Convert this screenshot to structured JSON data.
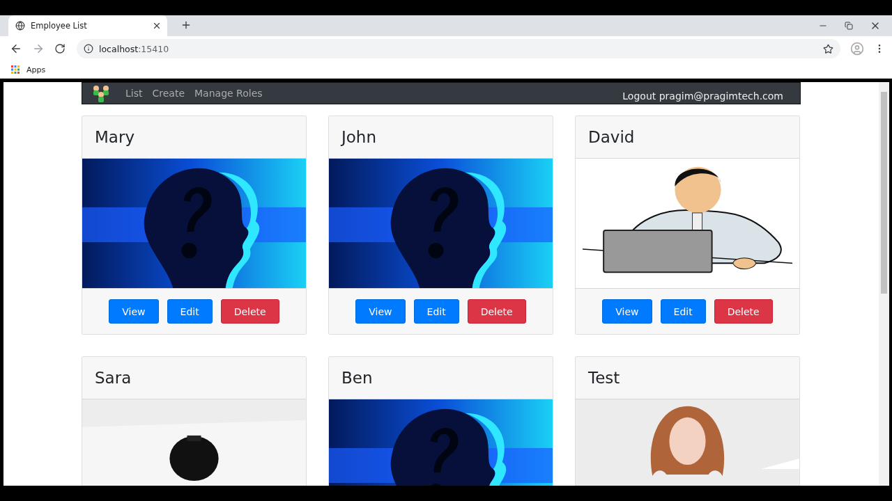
{
  "browser": {
    "tab": {
      "title": "Employee List"
    },
    "address": {
      "host": "localhost",
      "port": ":15410"
    },
    "bookmarks": [
      "Apps"
    ]
  },
  "navbar": {
    "links": [
      "List",
      "Create",
      "Manage Roles"
    ],
    "logout": "Logout pragim@pragimtech.com"
  },
  "employees": [
    {
      "name": "Mary",
      "actions": [
        {
          "label": "View",
          "kind": "primary"
        },
        {
          "label": "Edit",
          "kind": "primary"
        },
        {
          "label": "Delete",
          "kind": "danger"
        }
      ]
    },
    {
      "name": "John",
      "actions": [
        {
          "label": "View",
          "kind": "primary"
        },
        {
          "label": "Edit",
          "kind": "primary"
        },
        {
          "label": "Delete",
          "kind": "danger"
        }
      ]
    },
    {
      "name": "David",
      "actions": [
        {
          "label": "View",
          "kind": "primary"
        },
        {
          "label": "Edit",
          "kind": "primary"
        },
        {
          "label": "Delete",
          "kind": "danger"
        }
      ]
    },
    {
      "name": "Sara"
    },
    {
      "name": "Ben"
    },
    {
      "name": "Test"
    }
  ]
}
